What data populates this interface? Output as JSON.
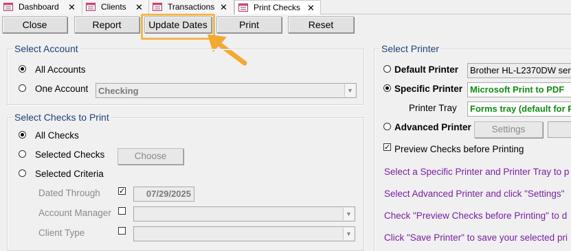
{
  "tabs": [
    {
      "label": "Dashboard",
      "active": false
    },
    {
      "label": "Clients",
      "active": false
    },
    {
      "label": "Transactions",
      "active": false
    },
    {
      "label": "Print Checks",
      "active": true
    }
  ],
  "toolbar": {
    "close": "Close",
    "report": "Report",
    "update_dates": "Update Dates",
    "print": "Print",
    "reset": "Reset"
  },
  "select_account": {
    "title": "Select Account",
    "all_accounts": "All Accounts",
    "one_account": "One Account",
    "account_value": "Checking",
    "selected": "all"
  },
  "select_checks": {
    "title": "Select Checks to Print",
    "all_checks": "All Checks",
    "selected_checks": "Selected Checks",
    "selected_criteria": "Selected Criteria",
    "choose": "Choose",
    "dated_through": "Dated Through",
    "dated_through_checked": true,
    "date_value": "07/29/2025",
    "account_manager": "Account Manager",
    "client_type": "Client Type",
    "selected": "all"
  },
  "select_printer": {
    "title": "Select Printer",
    "default_printer": "Default Printer",
    "default_printer_value": "Brother HL-L2370DW ser",
    "specific_printer": "Specific Printer",
    "specific_printer_value": "Microsoft Print to PDF",
    "printer_tray": "Printer Tray",
    "printer_tray_value": "Forms tray (default for P",
    "advanced_printer": "Advanced Printer",
    "settings": "Settings",
    "preview_checks": "Preview Checks before Printing",
    "preview_checked": true,
    "selected": "specific",
    "help": [
      "Select a Specific Printer and Printer Tray to p",
      "Select Advanced Printer and click \"Settings\"",
      "Check \"Preview Checks before Printing\" to d",
      "Click \"Save Printer\" to save your selected pri"
    ]
  },
  "colors": {
    "accent_highlight": "#f3b64c",
    "group_title": "#1f3f7a",
    "field_green": "#138a13",
    "help_purple": "#7a1fa2"
  }
}
